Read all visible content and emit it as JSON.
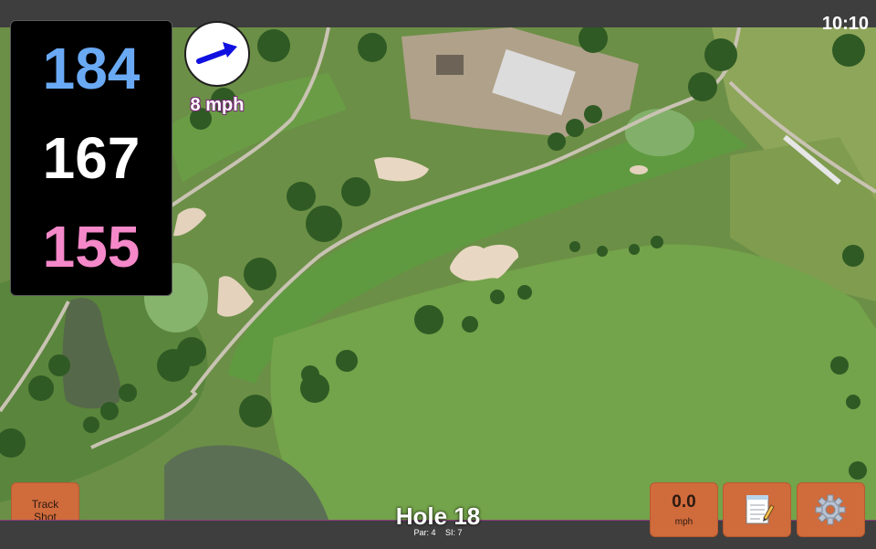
{
  "status_bar": {
    "time": "10:10"
  },
  "distances": {
    "back": "184",
    "middle": "167",
    "front": "155",
    "back_color": "#6aaaf5",
    "middle_color": "#ffffff",
    "front_color": "#f488c8"
  },
  "wind": {
    "speed": "8 mph",
    "arrow_icon": "wind-direction-arrow-icon",
    "arrow_color": "#1010e0"
  },
  "buttons": {
    "track_shot_line1": "Track",
    "track_shot_line2": "Shot",
    "speed_value": "0.0",
    "speed_unit": "mph",
    "notes_icon": "notepad-icon",
    "settings_icon": "gear-icon",
    "button_color": "#d06b3c"
  },
  "hole": {
    "title": "Hole 18",
    "par": "Par: 4",
    "stroke_index": "SI: 7"
  },
  "map": {
    "type": "satellite golf course view",
    "accent_border": "#8b3f7e"
  }
}
